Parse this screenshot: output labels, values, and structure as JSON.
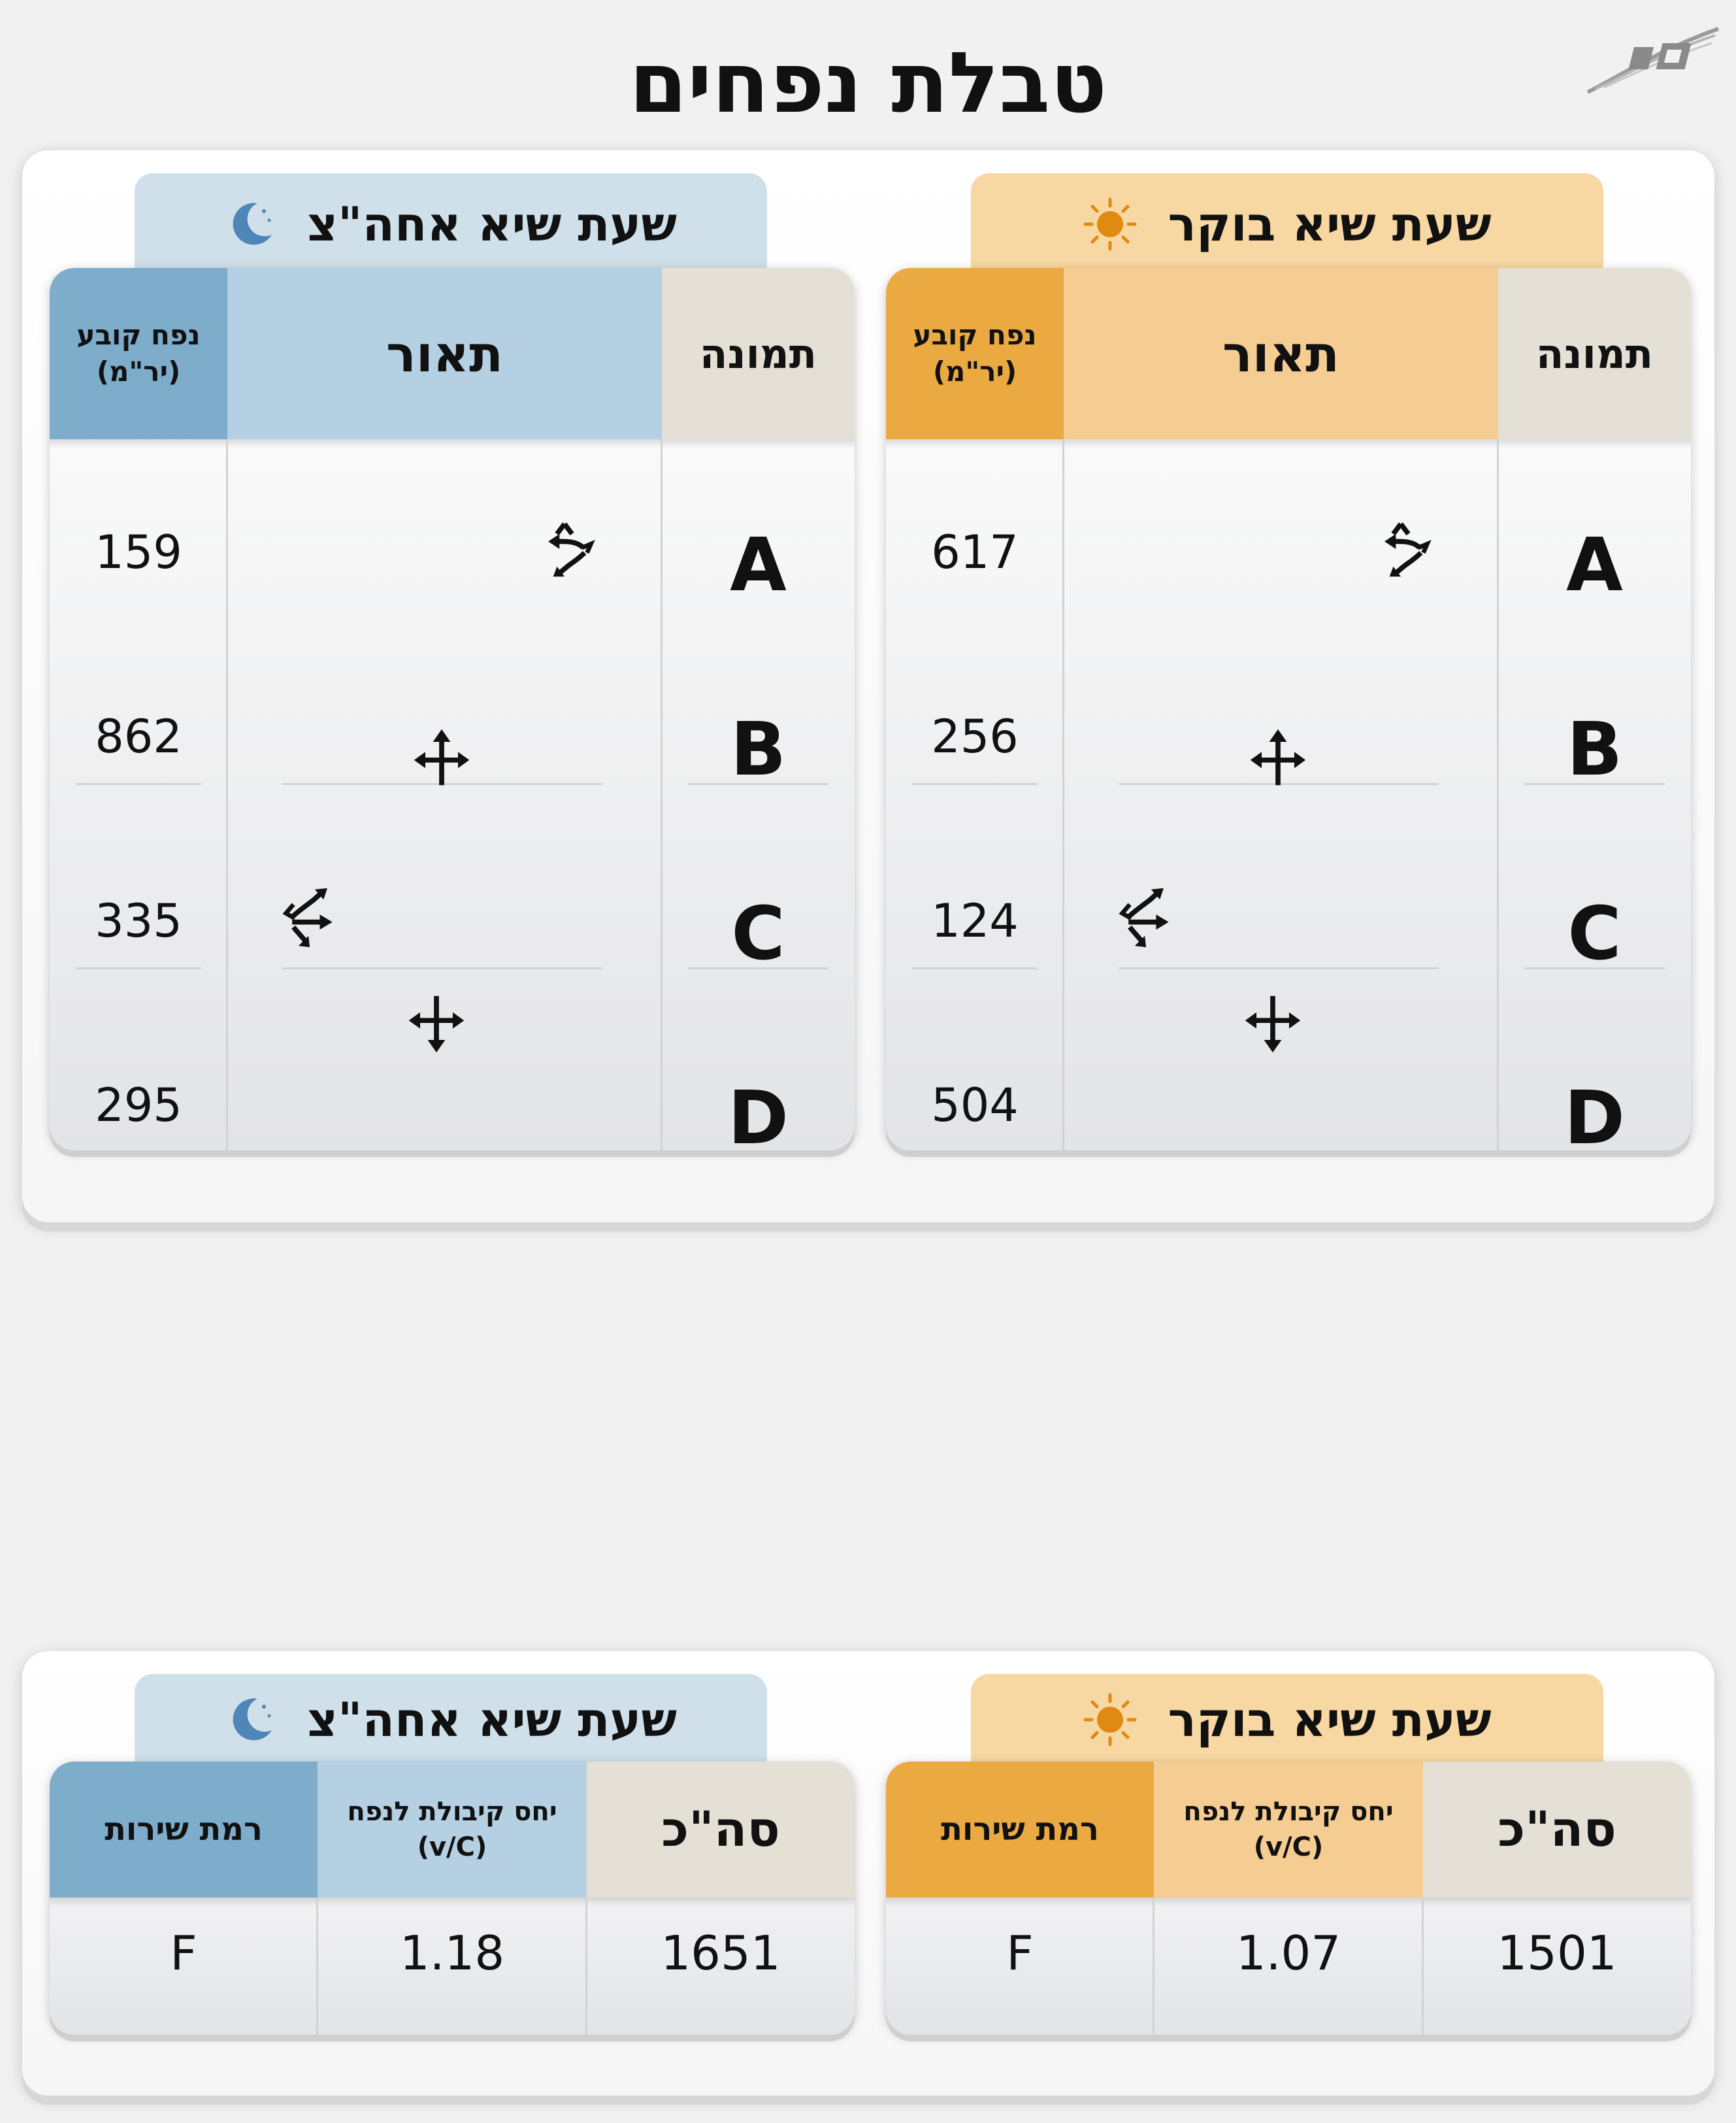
{
  "page": {
    "title": "טבלת נפחים"
  },
  "volumes": {
    "morning": {
      "tab_label": "שעת שיא בוקר",
      "headers": {
        "picture": "תמונה",
        "description": "תאור",
        "volume_line1": "נפח קובע",
        "volume_line2": "(יר\"מ)"
      },
      "rows": [
        {
          "phase": "A",
          "volume": "617"
        },
        {
          "phase": "B",
          "volume": "256"
        },
        {
          "phase": "C",
          "volume": "124"
        },
        {
          "phase": "D",
          "volume": "504"
        }
      ]
    },
    "evening": {
      "tab_label": "שעת שיא אחה\"צ",
      "headers": {
        "picture": "תמונה",
        "description": "תאור",
        "volume_line1": "נפח קובע",
        "volume_line2": "(יר\"מ)"
      },
      "rows": [
        {
          "phase": "A",
          "volume": "159"
        },
        {
          "phase": "B",
          "volume": "862"
        },
        {
          "phase": "C",
          "volume": "335"
        },
        {
          "phase": "D",
          "volume": "295"
        }
      ]
    }
  },
  "summary": {
    "morning": {
      "tab_label": "שעת שיא בוקר",
      "headers": {
        "total": "סה\"כ",
        "ratio_line1": "יחס קיבולת לנפח",
        "ratio_line2": "(v/C)",
        "los": "רמת שירות"
      },
      "values": {
        "total": "1501",
        "ratio": "1.07",
        "los": "F"
      }
    },
    "evening": {
      "tab_label": "שעת שיא אחה\"צ",
      "headers": {
        "total": "סה\"כ",
        "ratio_line1": "יחס קיבולת לנפח",
        "ratio_line2": "(v/C)",
        "los": "רמת שירות"
      },
      "values": {
        "total": "1651",
        "ratio": "1.18",
        "los": "F"
      }
    }
  },
  "icons": {
    "morning": "sun-icon",
    "evening": "moon-icon",
    "phase_a": "swap-arrows-icon",
    "phase_b": "four-way-arrows-icon",
    "phase_c": "swap-arrows-icon",
    "phase_d": "four-way-arrows-icon",
    "logo": "company-logo"
  },
  "colors": {
    "morning_light": "#f7d7a2",
    "morning_mid": "#f5cd92",
    "morning_dark": "#eba941",
    "evening_light": "#cfe0eb",
    "evening_mid": "#b4d0e2",
    "evening_dark": "#7eaccb",
    "picture_header": "#e5e0d6",
    "background": "#f1f1f1"
  }
}
